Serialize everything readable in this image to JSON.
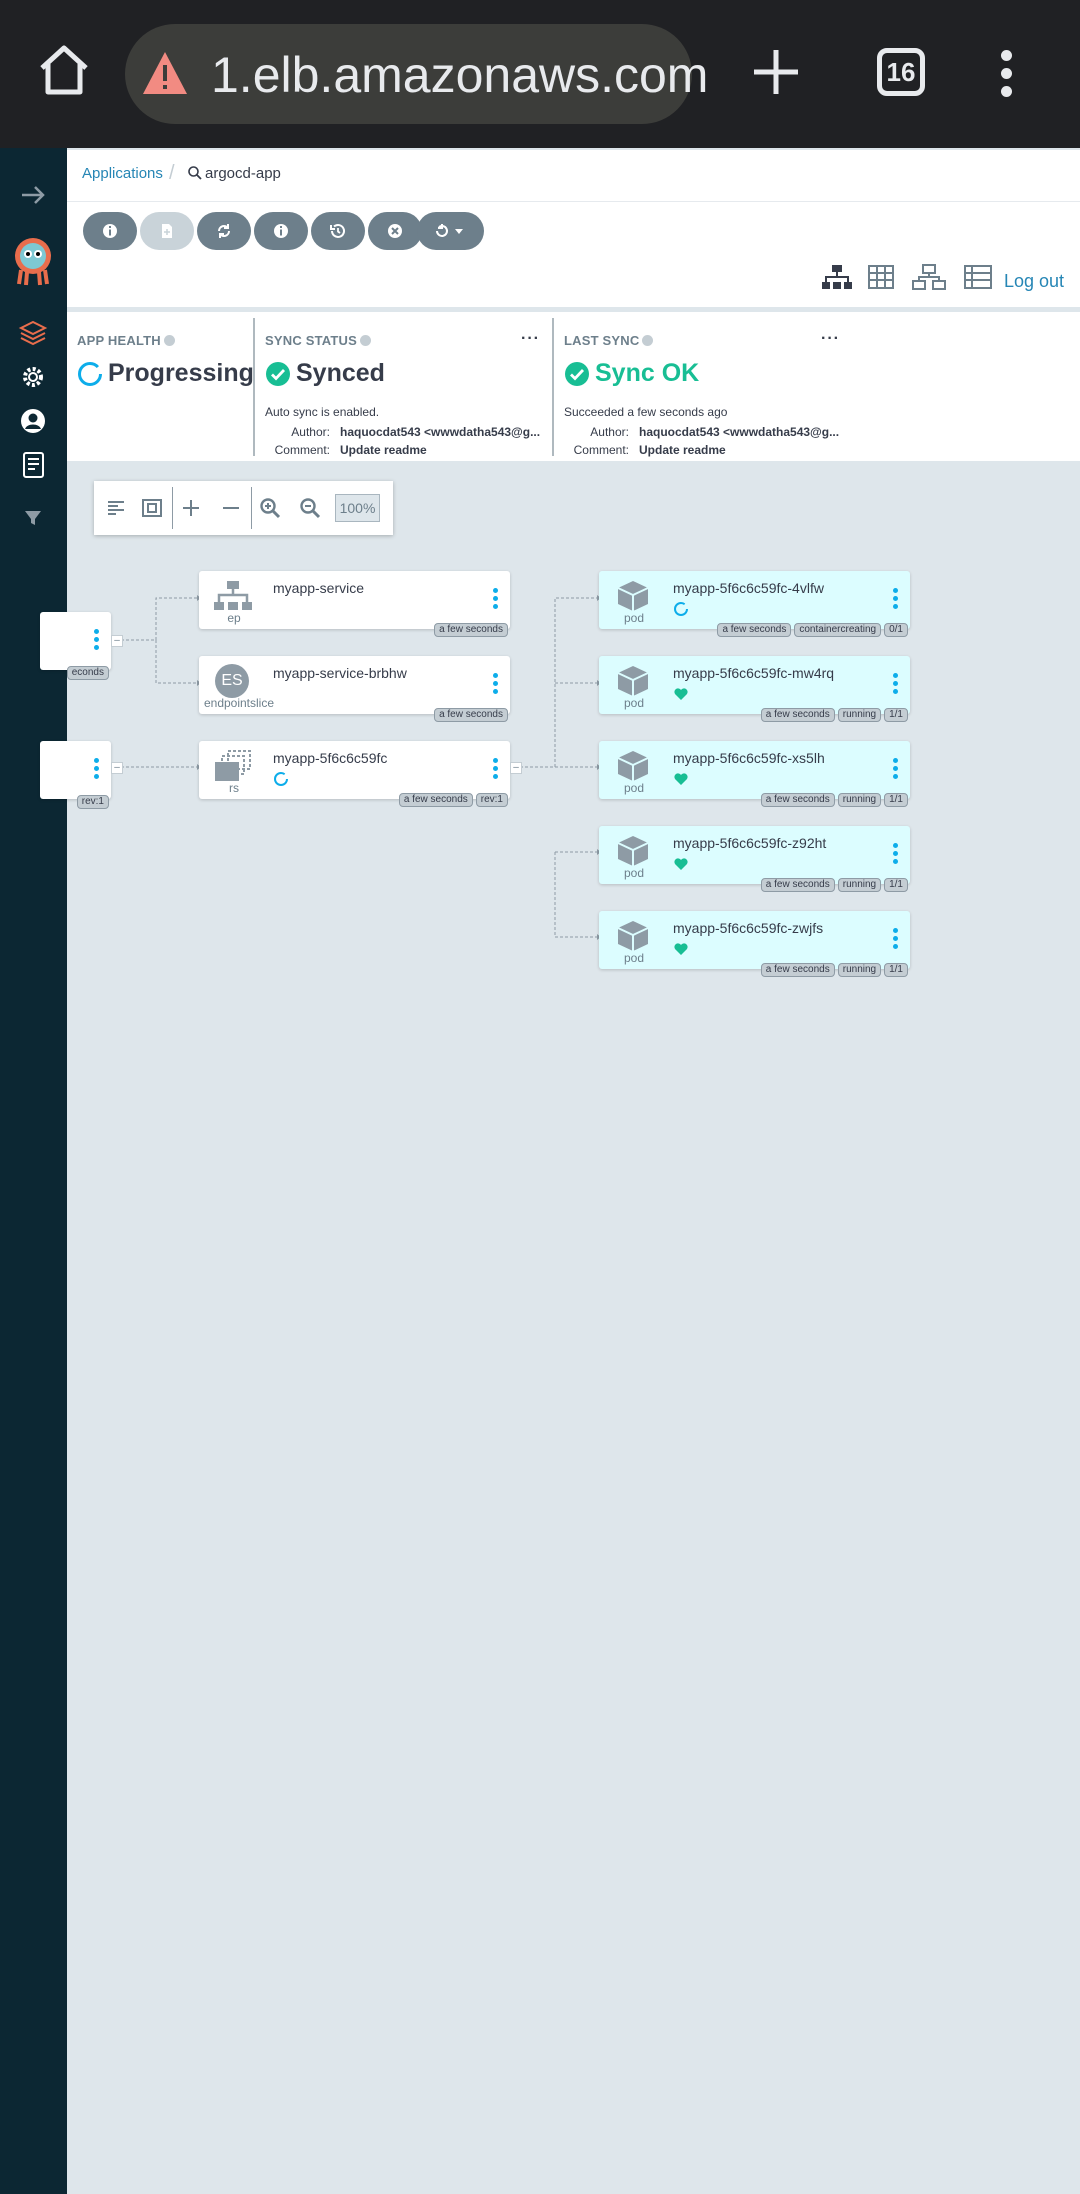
{
  "browser": {
    "url": "1.elb.amazonaws.com",
    "tab_count": "16"
  },
  "sidebar": {
    "items": [
      "expand-nav",
      "logo",
      "applications",
      "settings",
      "user-info",
      "documentation",
      "filter"
    ]
  },
  "breadcrumb": {
    "root": "Applications",
    "app": "argocd-app"
  },
  "toolbar": {
    "logout_label": "Log out"
  },
  "status": {
    "health": {
      "title": "APP HEALTH",
      "value": "Progressing"
    },
    "sync": {
      "title": "SYNC STATUS",
      "value": "Synced",
      "note": "Auto sync is enabled.",
      "author_label": "Author:",
      "author": "haquocdat543 <wwwdatha543@g...",
      "comment_label": "Comment:",
      "comment": "Update readme"
    },
    "last_sync": {
      "title": "LAST SYNC",
      "value": "Sync OK",
      "note": "Succeeded a few seconds ago",
      "author_label": "Author:",
      "author": "haquocdat543 <wwwdatha543@g...",
      "comment_label": "Comment:",
      "comment": "Update readme"
    },
    "colors": {
      "progressing": "#0dadea",
      "healthy": "#18be94"
    }
  },
  "graph": {
    "zoom_level": "100%",
    "left_partial": {
      "tag1": "econds",
      "tag2": "rev:1"
    },
    "nodes": [
      {
        "name": "myapp-service",
        "kind": "ep",
        "tags": [
          "a few seconds"
        ]
      },
      {
        "name": "myapp-service-brbhw",
        "kind": "endpointslice",
        "badge": "ES",
        "tags": [
          "a few seconds"
        ]
      },
      {
        "name": "myapp-5f6c6c59fc",
        "kind": "rs",
        "tags": [
          "a few seconds",
          "rev:1"
        ]
      },
      {
        "name": "myapp-5f6c6c59fc-4vlfw",
        "kind": "pod",
        "status": "progressing",
        "tags": [
          "a few seconds",
          "containercreating",
          "0/1"
        ]
      },
      {
        "name": "myapp-5f6c6c59fc-mw4rq",
        "kind": "pod",
        "status": "healthy",
        "tags": [
          "a few seconds",
          "running",
          "1/1"
        ]
      },
      {
        "name": "myapp-5f6c6c59fc-xs5lh",
        "kind": "pod",
        "status": "healthy",
        "tags": [
          "a few seconds",
          "running",
          "1/1"
        ]
      },
      {
        "name": "myapp-5f6c6c59fc-z92ht",
        "kind": "pod",
        "status": "healthy",
        "tags": [
          "a few seconds",
          "running",
          "1/1"
        ]
      },
      {
        "name": "myapp-5f6c6c59fc-zwjfs",
        "kind": "pod",
        "status": "healthy",
        "tags": [
          "a few seconds",
          "running",
          "1/1"
        ]
      }
    ]
  }
}
